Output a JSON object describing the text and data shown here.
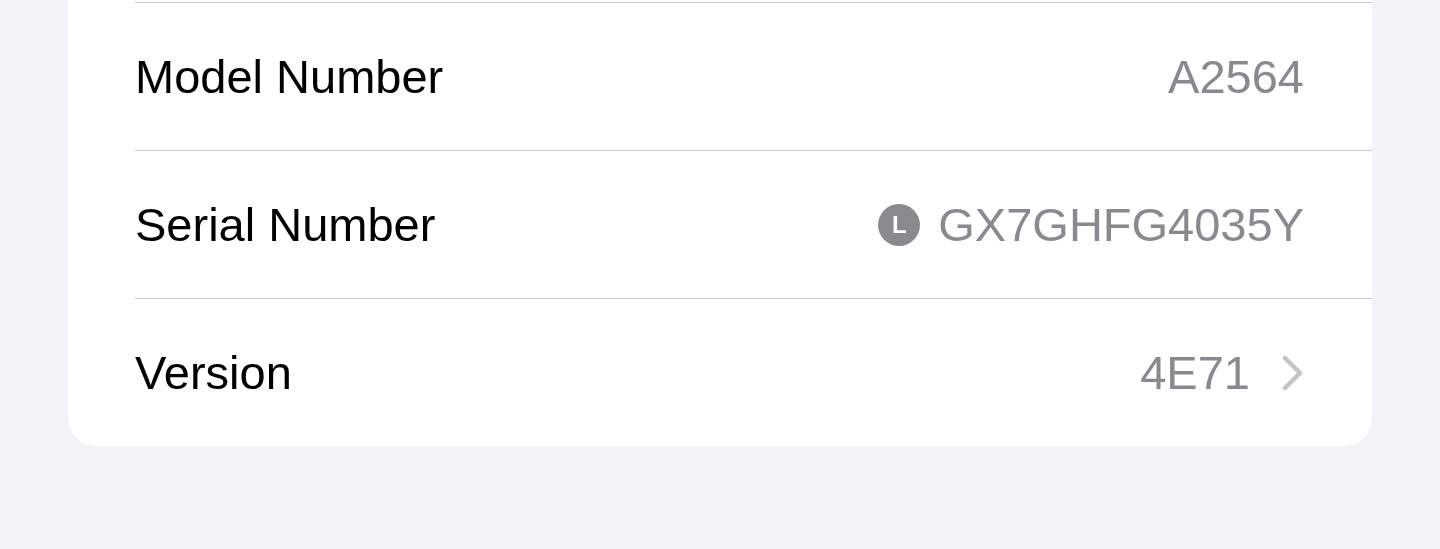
{
  "rows": [
    {
      "label": "Model Number",
      "value": "A2564",
      "chevron": false
    },
    {
      "label": "Serial Number",
      "value": "GX7GHFG4035Y",
      "badge": "L",
      "chevron": false
    },
    {
      "label": "Version",
      "value": "4E71",
      "chevron": true
    }
  ]
}
